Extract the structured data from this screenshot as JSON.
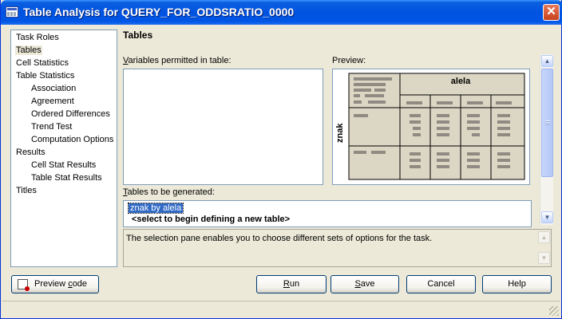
{
  "window": {
    "title": "Table Analysis for QUERY_FOR_ODDSRATIO_0000",
    "close_glyph": "✕"
  },
  "nav": {
    "items": [
      {
        "label": "Task Roles",
        "level": 0
      },
      {
        "label": "Tables",
        "level": 0,
        "selected": true
      },
      {
        "label": "Cell Statistics",
        "level": 0
      },
      {
        "label": "Table Statistics",
        "level": 0
      },
      {
        "label": "Association",
        "level": 1
      },
      {
        "label": "Agreement",
        "level": 1
      },
      {
        "label": "Ordered Differences",
        "level": 1
      },
      {
        "label": "Trend Test",
        "level": 1
      },
      {
        "label": "Computation Options",
        "level": 1
      },
      {
        "label": "Results",
        "level": 0
      },
      {
        "label": "Cell Stat Results",
        "level": 1
      },
      {
        "label": "Table Stat Results",
        "level": 1
      },
      {
        "label": "Titles",
        "level": 0
      }
    ]
  },
  "main": {
    "section_title": "Tables",
    "variables_label_first": "V",
    "variables_label_rest": "ariables permitted in table:",
    "preview_label": "Preview:",
    "preview": {
      "col_header": "alela",
      "row_header": "znak"
    },
    "tables_label_first": "T",
    "tables_label_rest": "ables to be generated:",
    "tables": {
      "selected_item": "znak by alela",
      "new_item": "<select to begin defining a new table>"
    },
    "info_text": "The selection pane enables you to choose different sets of options for the task."
  },
  "buttons": {
    "preview_code_pre": "Preview ",
    "preview_code_accel": "c",
    "preview_code_post": "ode",
    "run_accel": "R",
    "run_rest": "un",
    "save_accel": "S",
    "save_rest": "ave",
    "cancel": "Cancel",
    "help": "Help"
  },
  "icons": {
    "scroll_up": "▲",
    "scroll_down": "▼"
  }
}
